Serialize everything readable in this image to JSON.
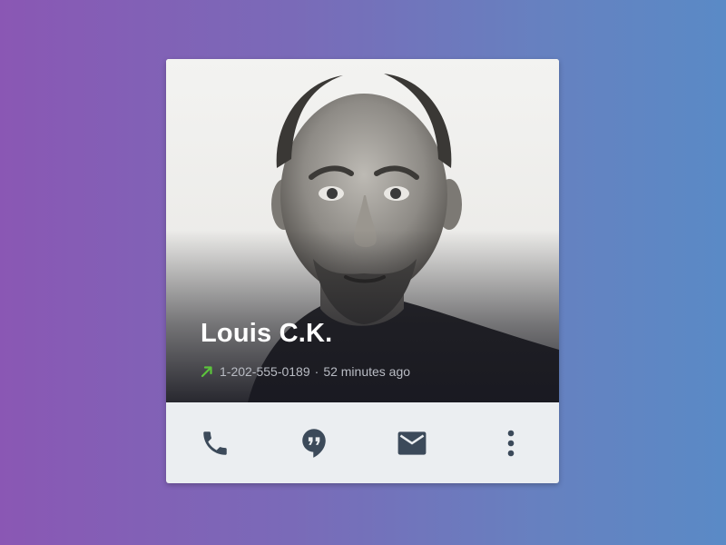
{
  "contact": {
    "name": "Louis C.K.",
    "phone": "1-202-555-0189",
    "separator": "·",
    "time_ago": "52 minutes ago",
    "call_direction_icon": "outgoing-call-arrow-icon"
  },
  "actions": [
    {
      "icon": "phone-icon",
      "label": "Call"
    },
    {
      "icon": "hangouts-icon",
      "label": "Hangouts"
    },
    {
      "icon": "mail-icon",
      "label": "Email"
    },
    {
      "icon": "more-vert-icon",
      "label": "More"
    }
  ],
  "colors": {
    "background_gradient_start": "#8a57b4",
    "background_gradient_end": "#5a8ac6",
    "action_bar_background": "#ebeef1",
    "icon_color": "#3c4a5a",
    "outgoing_arrow": "#5cc43c",
    "name_text": "#ffffff",
    "meta_text": "#b9bcc4"
  }
}
